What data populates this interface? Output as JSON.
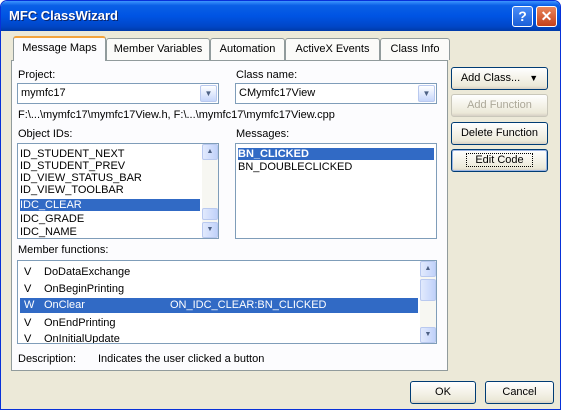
{
  "window": {
    "title": "MFC ClassWizard",
    "help_glyph": "?",
    "close_glyph": "✕"
  },
  "tabs": [
    "Message Maps",
    "Member Variables",
    "Automation",
    "ActiveX Events",
    "Class Info"
  ],
  "project": {
    "label": "Project:",
    "value": "mymfc17"
  },
  "class_name": {
    "label": "Class name:",
    "value": "CMymfc17View"
  },
  "path_text": "F:\\...\\mymfc17\\mymfc17View.h, F:\\...\\mymfc17\\mymfc17View.cpp",
  "object_ids": {
    "label": "Object IDs:",
    "items": [
      "ID_STUDENT_NEXT",
      "ID_STUDENT_PREV",
      "ID_VIEW_STATUS_BAR",
      "ID_VIEW_TOOLBAR",
      "IDC_CLEAR",
      "IDC_GRADE",
      "IDC_NAME"
    ],
    "selected": "IDC_CLEAR"
  },
  "messages": {
    "label": "Messages:",
    "items": [
      "BN_CLICKED",
      "BN_DOUBLECLICKED"
    ],
    "selected": "BN_CLICKED"
  },
  "member_functions": {
    "label": "Member functions:",
    "rows": [
      {
        "type": "V",
        "name": "DoDataExchange",
        "mapping": ""
      },
      {
        "type": "V",
        "name": "OnBeginPrinting",
        "mapping": ""
      },
      {
        "type": "W",
        "name": "OnClear",
        "mapping": "ON_IDC_CLEAR:BN_CLICKED"
      },
      {
        "type": "V",
        "name": "OnEndPrinting",
        "mapping": ""
      },
      {
        "type": "V",
        "name": "OnInitialUpdate",
        "mapping": ""
      }
    ],
    "selected": "OnClear"
  },
  "description": {
    "label": "Description:",
    "text": "Indicates the user clicked a button"
  },
  "buttons": {
    "add_class": "Add Class...",
    "add_function": "Add Function",
    "delete_function": "Delete Function",
    "edit_code": "Edit Code",
    "ok": "OK",
    "cancel": "Cancel"
  },
  "colors": {
    "selection": "#316ac5",
    "titlebar": "#0054e3",
    "tab_highlight": "#f4a43c"
  },
  "icons": [
    "help-icon",
    "close-icon",
    "dropdown-arrow-icon",
    "scroll-up-icon",
    "scroll-down-icon"
  ]
}
